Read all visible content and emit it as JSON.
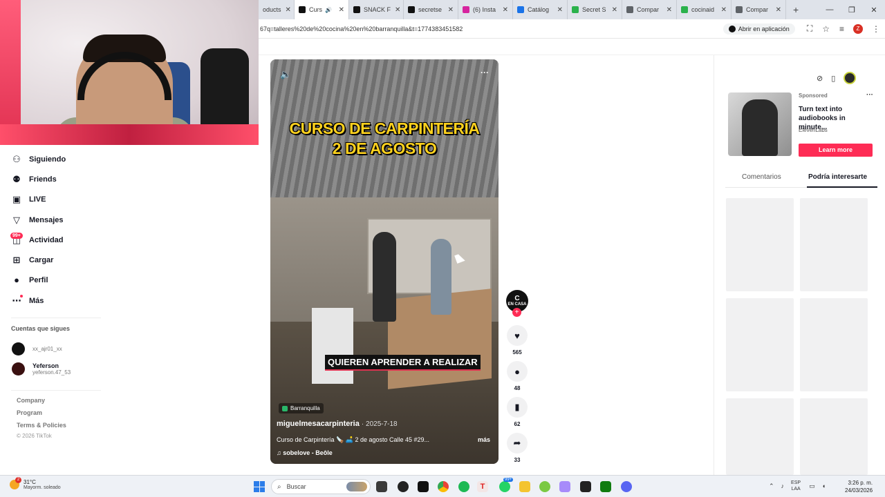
{
  "browser": {
    "tabs": [
      {
        "label": "oducts",
        "favicon_color": "#888888",
        "active": false
      },
      {
        "label": "Curs",
        "favicon_color": "#111111",
        "active": true
      },
      {
        "label": "SNACK F",
        "favicon_color": "#111111",
        "active": false
      },
      {
        "label": "secretse",
        "favicon_color": "#111111",
        "active": false
      },
      {
        "label": "(6) Insta",
        "favicon_color": "#d6249f",
        "active": false
      },
      {
        "label": "Catálog",
        "favicon_color": "#1a73e8",
        "active": false
      },
      {
        "label": "Secret S",
        "favicon_color": "#2bb24c",
        "active": false
      },
      {
        "label": "Compar",
        "favicon_color": "#5f6368",
        "active": false
      },
      {
        "label": "cocinaid",
        "favicon_color": "#2bb24c",
        "active": false
      },
      {
        "label": "Compar",
        "favicon_color": "#5f6368",
        "active": false
      }
    ],
    "new_tab": "+",
    "url": "67q=talleres%20de%20cocina%20en%20barranquilla&t=1774383451582",
    "open_in_app": "Abrir en aplicación",
    "profile_initial": "Z"
  },
  "nav": {
    "items": [
      {
        "label": "Siguiendo",
        "icon": "person-icon",
        "glyph": "⚇"
      },
      {
        "label": "Friends",
        "icon": "friends-icon",
        "glyph": "⚉"
      },
      {
        "label": "LIVE",
        "icon": "live-icon",
        "glyph": "▣"
      },
      {
        "label": "Mensajes",
        "icon": "send-icon",
        "glyph": "▽"
      },
      {
        "label": "Actividad",
        "icon": "activity-icon",
        "glyph": "◫"
      },
      {
        "label": "Cargar",
        "icon": "upload-icon",
        "glyph": "⊞"
      },
      {
        "label": "Perfil",
        "icon": "profile-icon",
        "glyph": "●"
      },
      {
        "label": "Más",
        "icon": "more-icon",
        "glyph": "⋯"
      }
    ],
    "activity_badge": "99+",
    "following_title": "Cuentas que sigues",
    "accounts": [
      {
        "name": "",
        "handle": "xx_ajr01_xx"
      },
      {
        "name": "Yeferson",
        "handle": "yeferson.47_53"
      }
    ],
    "footer": [
      "Company",
      "Program",
      "Terms & Policies"
    ],
    "copyright": "© 2026 TikTok"
  },
  "video": {
    "title_line1": "CURSO DE CARPINTERÍA",
    "title_line2": "2 DE AGOSTO",
    "caption_overlay": "QUIEREN APRENDER A REALIZAR",
    "location": "Barranquilla",
    "author": "miguelmesacarpinteria",
    "date": "· 2025-7-18",
    "description": "Curso de Carpintería 🪚 🛋️ 2 de agosto Calle 45 #29...",
    "more": "más",
    "music": "♫  sobelove - Beôle"
  },
  "actions": {
    "channel_badge_line1": "C",
    "channel_badge_line2": "EN CASA",
    "likes": "565",
    "comments": "48",
    "saves": "62",
    "shares": "33"
  },
  "right": {
    "sponsored": "Sponsored",
    "ad_title": "Turn text into audiobooks in minute...",
    "ad_brand": "ElevenLabs",
    "learn_more": "Learn more",
    "tab_comments": "Comentarios",
    "tab_interest": "Podría interesarte"
  },
  "taskbar": {
    "weather_temp": "31°C",
    "weather_desc": "Mayorm. soleado",
    "weather_badge": "2",
    "search_placeholder": "Buscar",
    "lang1": "ESP",
    "lang2": "LAA",
    "time": "3:26 p. m.",
    "date": "24/03/2026",
    "whatsapp_badge": "99+"
  },
  "colors": {
    "accent": "#fe2c55",
    "title_yellow": "#ffd21e"
  }
}
